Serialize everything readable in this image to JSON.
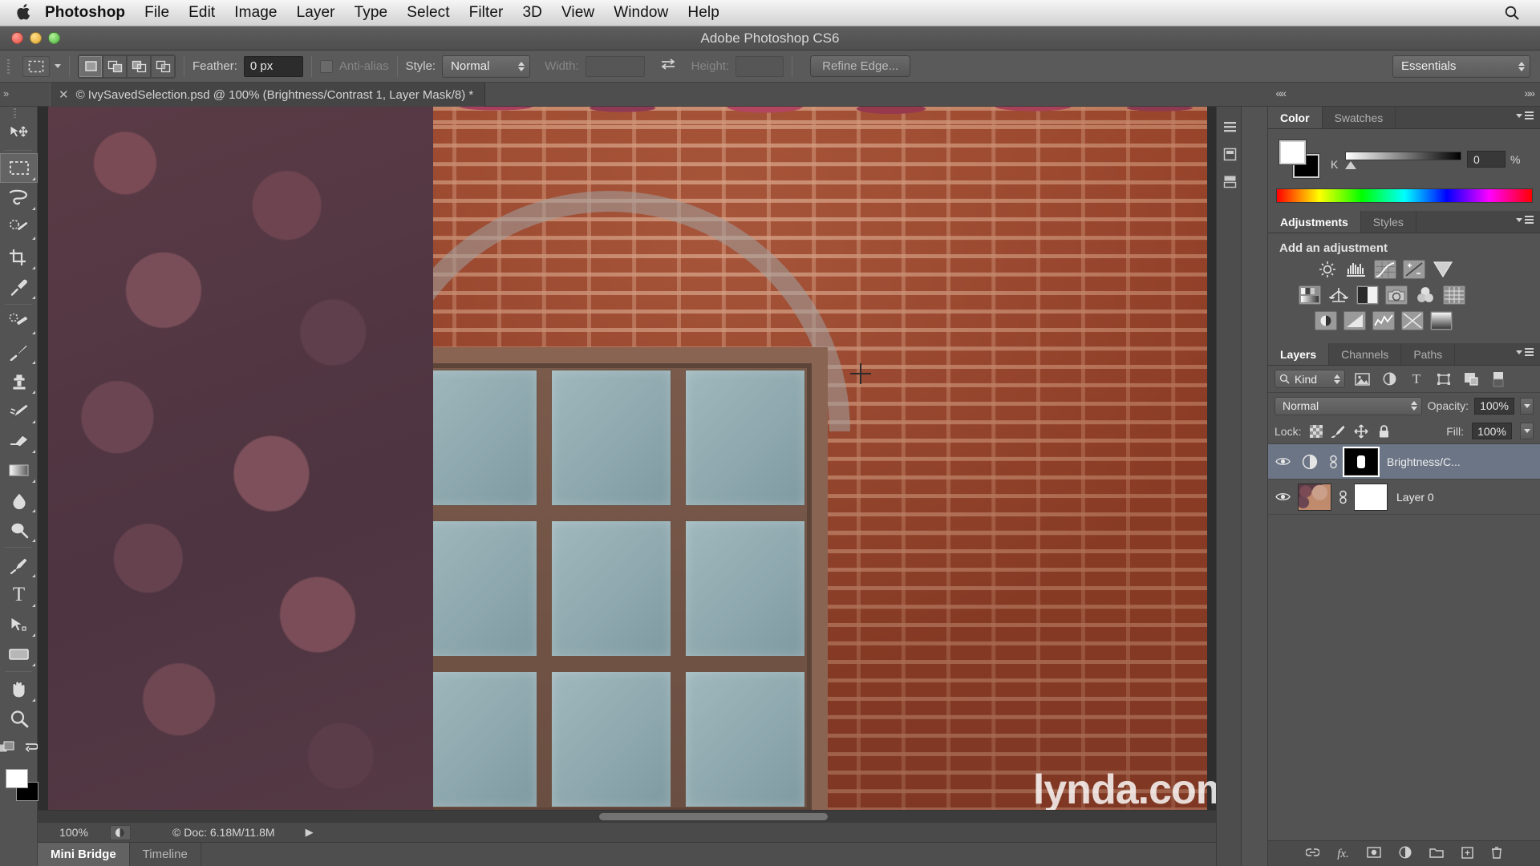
{
  "menubar": {
    "apple_icon": "apple-logo",
    "app_name": "Photoshop",
    "items": [
      "File",
      "Edit",
      "Image",
      "Layer",
      "Type",
      "Select",
      "Filter",
      "3D",
      "View",
      "Window",
      "Help"
    ],
    "search_icon": "search-icon"
  },
  "titlebar": {
    "title": "Adobe Photoshop CS6"
  },
  "options_bar": {
    "tool_preset_icon": "rectangular-marquee-icon",
    "selection_modes": [
      "new-selection",
      "add-to-selection",
      "subtract-from-selection",
      "intersect-with-selection"
    ],
    "active_selection_mode": "new-selection",
    "feather_label": "Feather:",
    "feather_value": "0 px",
    "antialias_label": "Anti-alias",
    "antialias_checked": false,
    "style_label": "Style:",
    "style_value": "Normal",
    "width_label": "Width:",
    "width_value": "",
    "swap_icon": "swap-arrows-icon",
    "height_label": "Height:",
    "height_value": "",
    "refine_edge_label": "Refine Edge...",
    "workspace_value": "Essentials"
  },
  "tabbar": {
    "doc_close_icon": "close-icon",
    "doc_title": "© IvySavedSelection.psd @ 100% (Brightness/Contrast 1, Layer Mask/8) *",
    "collapse_icon": "double-chevron-left-icon"
  },
  "toolbar": {
    "tools": [
      {
        "name": "move-tool",
        "glyph": "✥",
        "has_corner": false,
        "selected": false
      },
      {
        "name": "rectangular-marquee-tool",
        "glyph": "▭",
        "has_corner": true,
        "selected": true
      },
      {
        "name": "lasso-tool",
        "glyph": "◠",
        "has_corner": true,
        "selected": false
      },
      {
        "name": "quick-selection-tool",
        "glyph": "✧",
        "has_corner": true,
        "selected": false
      },
      {
        "name": "crop-tool",
        "glyph": "⌗",
        "has_corner": true,
        "selected": false
      },
      {
        "name": "eyedropper-tool",
        "glyph": "⚲",
        "has_corner": true,
        "selected": false
      },
      {
        "name": "spot-healing-brush-tool",
        "glyph": "✚",
        "has_corner": true,
        "selected": false
      },
      {
        "name": "brush-tool",
        "glyph": "✎",
        "has_corner": true,
        "selected": false
      },
      {
        "name": "clone-stamp-tool",
        "glyph": "⌶",
        "has_corner": true,
        "selected": false
      },
      {
        "name": "history-brush-tool",
        "glyph": "✐",
        "has_corner": true,
        "selected": false
      },
      {
        "name": "eraser-tool",
        "glyph": "▱",
        "has_corner": true,
        "selected": false
      },
      {
        "name": "gradient-tool",
        "glyph": "▤",
        "has_corner": true,
        "selected": false
      },
      {
        "name": "blur-tool",
        "glyph": "◐",
        "has_corner": true,
        "selected": false
      },
      {
        "name": "dodge-tool",
        "glyph": "◍",
        "has_corner": true,
        "selected": false
      },
      {
        "name": "pen-tool",
        "glyph": "✒",
        "has_corner": true,
        "selected": false
      },
      {
        "name": "horizontal-type-tool",
        "glyph": "T",
        "has_corner": true,
        "selected": false
      },
      {
        "name": "path-selection-tool",
        "glyph": "➤",
        "has_corner": true,
        "selected": false
      },
      {
        "name": "rectangle-tool",
        "glyph": "▭",
        "has_corner": true,
        "selected": false
      },
      {
        "name": "hand-tool",
        "glyph": "✋",
        "has_corner": true,
        "selected": false
      },
      {
        "name": "zoom-tool",
        "glyph": "⌕",
        "has_corner": false,
        "selected": false
      }
    ],
    "quickmask_icon": "quick-mask-icon",
    "screenmode_icon": "screen-mode-icon",
    "foreground_color": "#ffffff",
    "background_color": "#000000"
  },
  "canvas": {
    "image_description": "Brick wall with arched window covered in purple-red ivy leaves",
    "cursor_icon": "crosshair-cursor",
    "watermark": "lynda.com"
  },
  "statusbar": {
    "zoom_level": "100%",
    "thumb_icon": "document-thumbnail-icon",
    "doc_info": "© Doc: 6.18M/11.8M",
    "play_icon": "play-arrow-icon"
  },
  "bottom_tabs": {
    "tabs": [
      {
        "label": "Mini Bridge",
        "active": true
      },
      {
        "label": "Timeline",
        "active": false
      }
    ],
    "menu_icon": "panel-menu-icon"
  },
  "dockstrip": {
    "icons": [
      "history-dock-icon",
      "properties-dock-icon",
      "brush-dock-icon"
    ]
  },
  "color_panel": {
    "tabs": [
      {
        "label": "Color",
        "active": true
      },
      {
        "label": "Swatches",
        "active": false
      }
    ],
    "menu_icon": "panel-menu-icon",
    "foreground_swatch": "#ffffff",
    "background_swatch": "#000000",
    "channel_label": "K",
    "channel_value": "0",
    "percent_label": "%"
  },
  "adjustments_panel": {
    "tabs": [
      {
        "label": "Adjustments",
        "active": true
      },
      {
        "label": "Styles",
        "active": false
      }
    ],
    "menu_icon": "panel-menu-icon",
    "heading": "Add an adjustment",
    "row1": [
      "brightness-contrast-icon",
      "levels-icon",
      "curves-icon",
      "exposure-icon",
      "vibrance-icon"
    ],
    "row2": [
      "hue-saturation-icon",
      "color-balance-icon",
      "black-white-icon",
      "photo-filter-icon",
      "channel-mixer-icon",
      "color-lookup-icon"
    ],
    "row3": [
      "invert-icon",
      "posterize-icon",
      "threshold-icon",
      "gradient-map-icon",
      "selective-color-icon"
    ]
  },
  "layers_panel": {
    "tabs": [
      {
        "label": "Layers",
        "active": true
      },
      {
        "label": "Channels",
        "active": false
      },
      {
        "label": "Paths",
        "active": false
      }
    ],
    "menu_icon": "panel-menu-icon",
    "filter_label": "Kind",
    "filter_search_icon": "search-icon",
    "filter_icons": [
      "filter-pixel-icon",
      "filter-adjustment-icon",
      "filter-type-icon",
      "filter-shape-icon",
      "filter-smartobject-icon"
    ],
    "filter_toggle_icon": "filter-toggle-icon",
    "blend_mode": "Normal",
    "opacity_label": "Opacity:",
    "opacity_value": "100%",
    "lock_label": "Lock:",
    "lock_icons": [
      "lock-transparent-pixels-icon",
      "lock-image-pixels-icon",
      "lock-position-icon",
      "lock-all-icon"
    ],
    "fill_label": "Fill:",
    "fill_value": "100%",
    "layers": [
      {
        "name": "Brightness/C...",
        "visible": true,
        "selected": true,
        "type_icon": "adjustment-layer-icon",
        "link_icon": "link-icon",
        "mask": "black-mask-thumbnail"
      },
      {
        "name": "Layer 0",
        "visible": true,
        "selected": false,
        "type_icon": "image-thumbnail",
        "link_icon": "link-icon",
        "mask": "white-mask-thumbnail"
      }
    ],
    "footer_icons": [
      "link-layers-icon",
      "add-layer-style-icon",
      "add-layer-mask-icon",
      "new-adjustment-layer-icon",
      "new-group-icon",
      "new-layer-icon",
      "delete-layer-icon"
    ]
  },
  "colors": {
    "panel_bg": "#535353",
    "panel_tab_bg": "#464646",
    "selected_layer_bg": "#6b7585",
    "options_bar_bg": "#5a5a5a",
    "canvas_bg": "#2e2e2e"
  }
}
